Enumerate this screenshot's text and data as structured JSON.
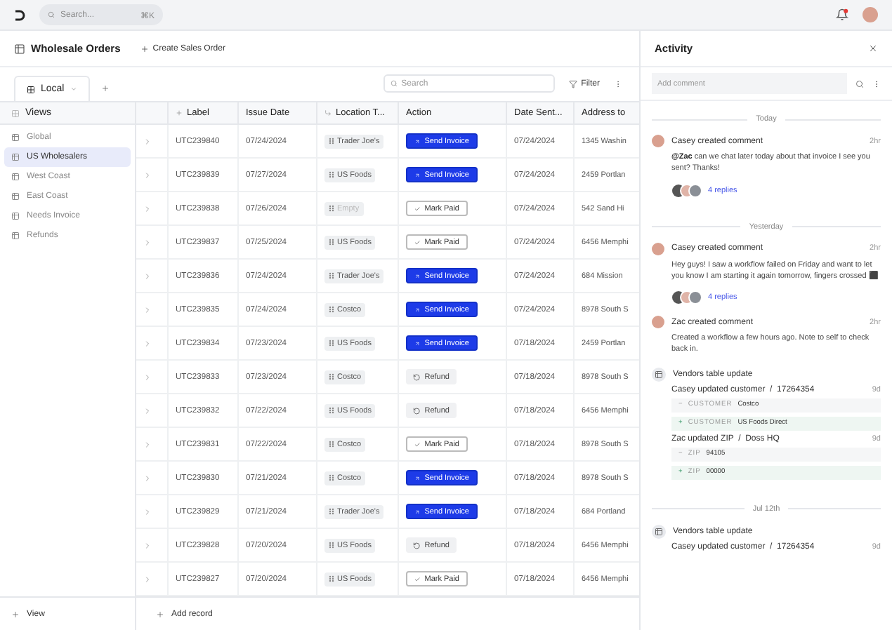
{
  "topbar": {
    "search": {
      "placeholder": "Search...",
      "shortcut": "⌘K"
    },
    "notifications": {
      "unread": true
    }
  },
  "header": {
    "title": "Wholesale Orders",
    "action": "Create Sales Order"
  },
  "view_tabs": [
    {
      "label": "Local",
      "selected": true
    }
  ],
  "toolbar": {
    "search": {
      "placeholder": "Search"
    },
    "filter": "Filter"
  },
  "sidebar": {
    "title": "Views",
    "items": [
      {
        "label": "Global",
        "selected": false
      },
      {
        "label": "US Wholesalers",
        "selected": true
      },
      {
        "label": "West Coast",
        "selected": false
      },
      {
        "label": "East Coast",
        "selected": false
      },
      {
        "label": "Needs Invoice",
        "selected": false
      },
      {
        "label": "Refunds",
        "selected": false
      }
    ],
    "footer": "View"
  },
  "table": {
    "columns": [
      "Label",
      "Issue Date",
      "Location T...",
      "Action",
      "Date Sent...",
      "Address to"
    ],
    "rows": [
      {
        "label": "UTC239840",
        "issue_date": "07/24/2024",
        "location": "Trader Joe's",
        "location_empty": false,
        "action": {
          "kind": "send",
          "label": "Send Invoice"
        },
        "date_sent": "07/24/2024",
        "address": "1345 Washin"
      },
      {
        "label": "UTC239839",
        "issue_date": "07/27/2024",
        "location": "US Foods",
        "location_empty": false,
        "action": {
          "kind": "send",
          "label": "Send Invoice"
        },
        "date_sent": "07/24/2024",
        "address": "2459 Portlan"
      },
      {
        "label": "UTC239838",
        "issue_date": "07/26/2024",
        "location": "Empty",
        "location_empty": true,
        "action": {
          "kind": "mark_paid",
          "label": "Mark Paid"
        },
        "date_sent": "07/24/2024",
        "address": "542 Sand Hi"
      },
      {
        "label": "UTC239837",
        "issue_date": "07/25/2024",
        "location": "US Foods",
        "location_empty": false,
        "action": {
          "kind": "mark_paid",
          "label": "Mark Paid"
        },
        "date_sent": "07/24/2024",
        "address": "6456 Memphi"
      },
      {
        "label": "UTC239836",
        "issue_date": "07/24/2024",
        "location": "Trader Joe's",
        "location_empty": false,
        "action": {
          "kind": "send",
          "label": "Send Invoice"
        },
        "date_sent": "07/24/2024",
        "address": "684 Mission"
      },
      {
        "label": "UTC239835",
        "issue_date": "07/24/2024",
        "location": "Costco",
        "location_empty": false,
        "action": {
          "kind": "send",
          "label": "Send Invoice"
        },
        "date_sent": "07/24/2024",
        "address": "8978 South S"
      },
      {
        "label": "UTC239834",
        "issue_date": "07/23/2024",
        "location": "US Foods",
        "location_empty": false,
        "action": {
          "kind": "send",
          "label": "Send Invoice"
        },
        "date_sent": "07/18/2024",
        "address": "2459 Portlan"
      },
      {
        "label": "UTC239833",
        "issue_date": "07/23/2024",
        "location": "Costco",
        "location_empty": false,
        "action": {
          "kind": "refund",
          "label": "Refund"
        },
        "date_sent": "07/18/2024",
        "address": "8978 South S"
      },
      {
        "label": "UTC239832",
        "issue_date": "07/22/2024",
        "location": "US Foods",
        "location_empty": false,
        "action": {
          "kind": "refund",
          "label": "Refund"
        },
        "date_sent": "07/18/2024",
        "address": "6456 Memphi"
      },
      {
        "label": "UTC239831",
        "issue_date": "07/22/2024",
        "location": "Costco",
        "location_empty": false,
        "action": {
          "kind": "mark_paid",
          "label": "Mark Paid"
        },
        "date_sent": "07/18/2024",
        "address": "8978 South S"
      },
      {
        "label": "UTC239830",
        "issue_date": "07/21/2024",
        "location": "Costco",
        "location_empty": false,
        "action": {
          "kind": "send",
          "label": "Send Invoice"
        },
        "date_sent": "07/18/2024",
        "address": "8978 South S"
      },
      {
        "label": "UTC239829",
        "issue_date": "07/21/2024",
        "location": "Trader Joe's",
        "location_empty": false,
        "action": {
          "kind": "send",
          "label": "Send Invoice"
        },
        "date_sent": "07/18/2024",
        "address": "684 Portland"
      },
      {
        "label": "UTC239828",
        "issue_date": "07/20/2024",
        "location": "US Foods",
        "location_empty": false,
        "action": {
          "kind": "refund",
          "label": "Refund"
        },
        "date_sent": "07/18/2024",
        "address": "6456 Memphi"
      },
      {
        "label": "UTC239827",
        "issue_date": "07/20/2024",
        "location": "US Foods",
        "location_empty": false,
        "action": {
          "kind": "mark_paid",
          "label": "Mark Paid"
        },
        "date_sent": "07/18/2024",
        "address": "6456 Memphi"
      }
    ],
    "footer": "Add record"
  },
  "activity": {
    "title": "Activity",
    "comment_field": {
      "placeholder": "Add comment"
    },
    "feed": [
      {
        "kind": "divider",
        "label": "Today"
      },
      {
        "kind": "comment",
        "author_line": "Casey created comment",
        "time": "2hr",
        "text": "**@Zac** can we chat later today about that invoice I see you sent? Thanks!",
        "replies": "4 replies"
      },
      {
        "kind": "divider",
        "label": "Yesterday"
      },
      {
        "kind": "comment",
        "author_line": "Casey created comment",
        "time": "2hr",
        "text": "Hey guys! I saw a workflow failed on Friday and want to let you know I am starting it again tomorrow, fingers crossed ⬛",
        "replies": "4 replies"
      },
      {
        "kind": "comment",
        "author_line": "Zac created comment",
        "time": "2hr",
        "text": "Created a workflow a few hours ago. Note to self to check back in."
      },
      {
        "kind": "update",
        "title": "Vendors table update",
        "changes": [
          {
            "summary": "Casey updated customer  /  17264354",
            "time": "9d",
            "diffs": [
              {
                "kind": "removed",
                "sign": "−",
                "field": "CUSTOMER",
                "value": "Costco"
              },
              {
                "kind": "added",
                "sign": "+",
                "field": "CUSTOMER",
                "value": "US Foods Direct"
              }
            ]
          },
          {
            "summary": "Zac updated ZIP  /  Doss HQ",
            "time": "9d",
            "diffs": [
              {
                "kind": "removed",
                "sign": "−",
                "field": "ZIP",
                "value": "94105"
              },
              {
                "kind": "added",
                "sign": "+",
                "field": "ZIP",
                "value": "00000"
              }
            ]
          }
        ]
      },
      {
        "kind": "divider",
        "label": "Jul 12th"
      },
      {
        "kind": "update",
        "title": "Vendors table update",
        "changes": [
          {
            "summary": "Casey updated customer  /  17264354",
            "time": "9d"
          }
        ]
      }
    ]
  }
}
